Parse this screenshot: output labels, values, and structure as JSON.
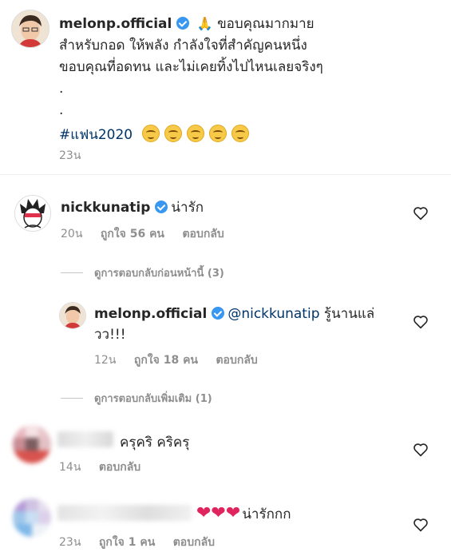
{
  "post": {
    "username": "melonp.official",
    "caption_line1": "ขอบคุณมากมาย",
    "prayer_emoji": "🙏",
    "caption_line2": "สำหรับกอด ให้พลัง กำลังใจที่สำคัญคนหนึ่ง",
    "caption_line3": "ขอบคุณที่อดทน และไม่เคยทิ้งไปไหนเลยจริงๆ",
    "dot1": ".",
    "dot2": ".",
    "hashtag": "#แฟน2020",
    "time": "23น"
  },
  "comment1": {
    "username": "nickkunatip",
    "text": "น่ารัก",
    "time": "20น",
    "likes": "ถูกใจ 56 คน",
    "reply": "ตอบกลับ"
  },
  "view_prev_replies": "ดูการตอบกลับก่อนหน้านี้ (3)",
  "reply1": {
    "username": "melonp.official",
    "mention": "@nickkunatip",
    "text_a": "รู้นานแล่",
    "text_b": "วว!!!",
    "time": "12น",
    "likes": "ถูกใจ 18 คน",
    "reply": "ตอบกลับ"
  },
  "view_more_replies": "ดูการตอบกลับเพิ่มเติม (1)",
  "comment2": {
    "text": "ครุคริ คริครุ",
    "time": "14น",
    "reply": "ตอบกลับ"
  },
  "comment3": {
    "hearts": "❤❤❤",
    "text": "น่ารักกก",
    "time": "23น",
    "likes": "ถูกใจ 1 คน",
    "reply": "ตอบกลับ"
  },
  "colors": {
    "verified": "#3897f0",
    "hashtag": "#003569",
    "meta": "#8e8e8e"
  }
}
